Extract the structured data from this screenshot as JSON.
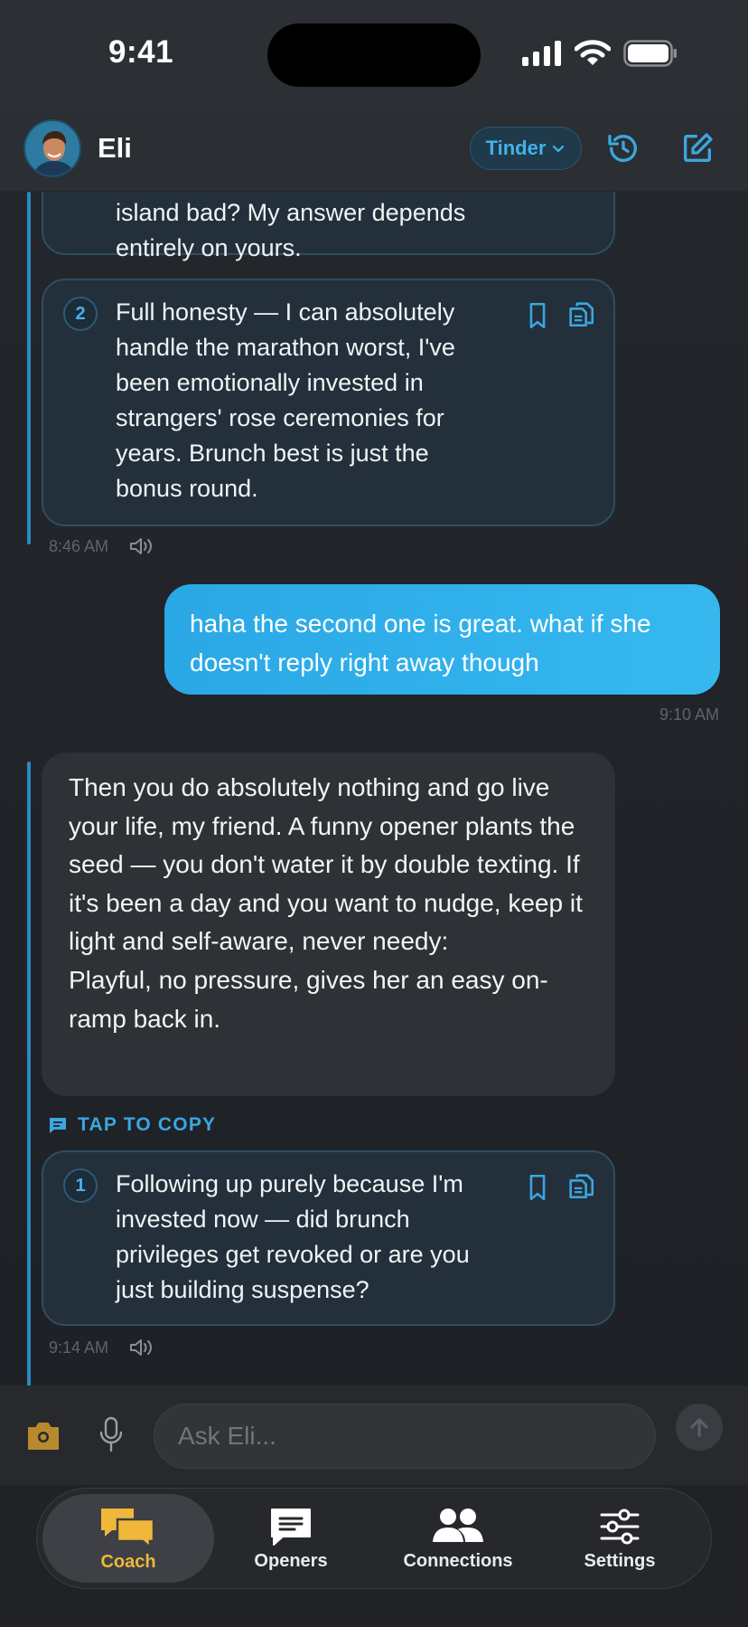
{
  "status": {
    "time": "9:41"
  },
  "header": {
    "name": "Eli",
    "platform": "Tinder"
  },
  "replies_top": {
    "partial_text": "island bad? My answer depends entirely on yours.",
    "card2": {
      "number": "2",
      "text": "Full honesty — I can absolutely handle the marathon worst, I've been emotionally invested in strangers' rose ceremonies for years. Brunch best is just the bonus round."
    },
    "time": "8:46 AM"
  },
  "user_message": {
    "text": "haha the second one is great. what if she doesn't reply right away though",
    "time": "9:10 AM"
  },
  "ai_message": {
    "text": "Then you do absolutely nothing and go live your life, my friend. A funny opener plants the seed — you don't water it by double texting. If it's been a day and you want to nudge, keep it light and self-aware, never needy:\nPlayful, no pressure, gives her an easy on-ramp back in.",
    "tap_to_copy": "TAP TO COPY",
    "card1": {
      "number": "1",
      "text": "Following up purely because I'm invested now — did brunch privileges get revoked or are you just building suspense?"
    },
    "time": "9:14 AM"
  },
  "composer": {
    "placeholder": "Ask Eli..."
  },
  "tabs": [
    {
      "label": "Coach",
      "icon": "chat-bubbles-icon",
      "active": true
    },
    {
      "label": "Openers",
      "icon": "message-icon",
      "active": false
    },
    {
      "label": "Connections",
      "icon": "people-icon",
      "active": false
    },
    {
      "label": "Settings",
      "icon": "sliders-icon",
      "active": false
    }
  ],
  "colors": {
    "accent": "#2aa8e6",
    "active_tab": "#f0b73a",
    "background": "#1f2227"
  }
}
